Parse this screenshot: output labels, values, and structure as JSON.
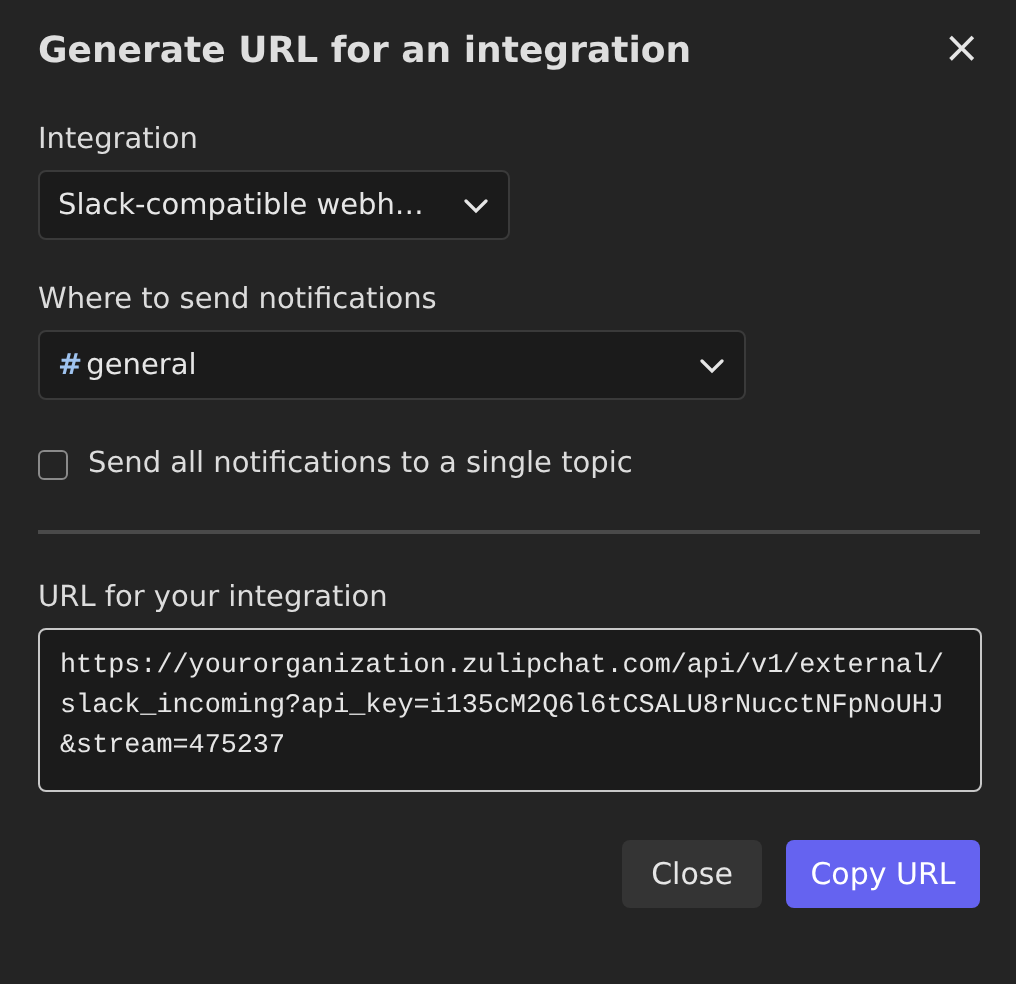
{
  "dialog": {
    "title": "Generate URL for an integration",
    "close_icon": "×"
  },
  "integration": {
    "label": "Integration",
    "value": "Slack-compatible webh…"
  },
  "destination": {
    "label": "Where to send notifications",
    "channel_mark": "#",
    "value": "general"
  },
  "single_topic": {
    "label": "Send all notifications to a single topic",
    "checked": false
  },
  "url": {
    "label": "URL for your integration",
    "value": "https://yourorganization.zulipchat.com/api/v1/external/slack_incoming?api_key=i135cM2Q6l6tCSALU8rNucctNFpNoUHJ&stream=475237"
  },
  "buttons": [
    {
      "label": "Close",
      "kind": "secondary"
    },
    {
      "label": "Copy URL",
      "kind": "primary"
    }
  ]
}
